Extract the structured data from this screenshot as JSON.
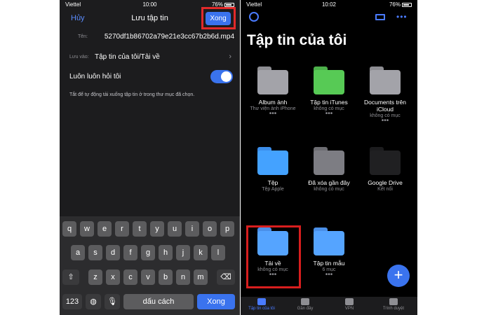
{
  "left": {
    "status": {
      "carrier": "Viettel",
      "time": "10:00",
      "battery": "76%"
    },
    "nav": {
      "cancel": "Hủy",
      "title": "Lưu tập tin",
      "done": "Xong"
    },
    "filename": {
      "label": "Tên:",
      "value": "5270df1b86702a79e21e3cc67b2b6d.mp4"
    },
    "save_to": {
      "label": "Lưu vào:",
      "value": "Tập tin của tôi/Tải về"
    },
    "always_ask": {
      "label": "Luôn luôn hỏi tôi",
      "on": true
    },
    "note": "Tắt để tự động tải xuống tập tin ở trong thư mục đã chọn.",
    "keyboard": {
      "row1": [
        "q",
        "w",
        "e",
        "r",
        "t",
        "y",
        "u",
        "i",
        "o",
        "p"
      ],
      "row2": [
        "a",
        "s",
        "d",
        "f",
        "g",
        "h",
        "j",
        "k",
        "l"
      ],
      "row3": [
        "z",
        "x",
        "c",
        "v",
        "b",
        "n",
        "m"
      ],
      "shift_icon": "shift-icon",
      "delete_icon": "backspace-icon",
      "num": "123",
      "globe_icon": "globe-icon",
      "mic_icon": "mic-icon",
      "space": "dấu cách",
      "go": "Xong"
    }
  },
  "right": {
    "status": {
      "carrier": "Viettel",
      "time": "10:02",
      "battery": "76%"
    },
    "title": "Tập tin của tôi",
    "items": [
      {
        "name": "Album ảnh",
        "sub": "Thư viện ảnh iPhone",
        "more": "•••",
        "color": "#8e8e93",
        "icon": "photos-icon"
      },
      {
        "name": "Tập tin iTunes",
        "sub": "không có mục",
        "more": "•••",
        "color": "#4cb04a",
        "icon": "itunes-icon"
      },
      {
        "name": "Documents trên iCloud",
        "sub": "không có mục",
        "more": "•••",
        "color": "#8e8e93",
        "icon": "documents-icon"
      },
      {
        "name": "Tệp",
        "sub": "Tệp Apple",
        "more": "",
        "color": "#3b8dea",
        "icon": "apple-icon"
      },
      {
        "name": "Đã xóa gần đây",
        "sub": "không có mục",
        "more": "",
        "color": "#6d6d72",
        "icon": "trash-icon"
      },
      {
        "name": "Google Drive",
        "sub": "Kết nối",
        "more": "",
        "color": "#1c1c1e",
        "icon": "google-drive-icon"
      },
      {
        "name": "Tải về",
        "sub": "không có mục",
        "more": "•••",
        "color": "#4a8fe8",
        "icon": "download-folder-icon"
      },
      {
        "name": "Tập tin mẫu",
        "sub": "6 mục",
        "more": "•••",
        "color": "#4a8fe8",
        "icon": "folder-icon"
      }
    ],
    "tabs": [
      {
        "label": "Tập tin của tôi",
        "active": true
      },
      {
        "label": "Gần đây",
        "active": false
      },
      {
        "label": "VPN",
        "active": false
      },
      {
        "label": "Trình duyệt",
        "active": false
      }
    ],
    "fab": "+"
  }
}
